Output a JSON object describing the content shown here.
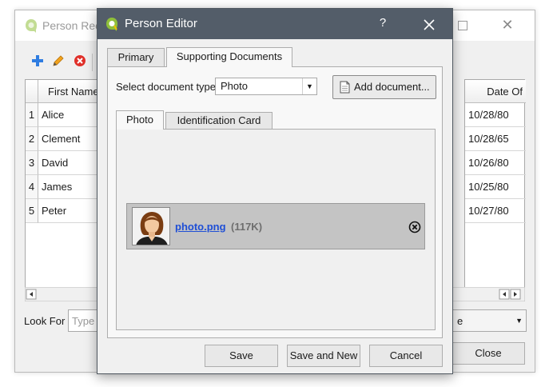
{
  "background_window": {
    "title": "Person Rec",
    "toolbar": {
      "add_icon": "plus-icon",
      "edit_icon": "pencil-icon",
      "delete_icon": "delete-icon"
    },
    "table": {
      "first_name_header": "First Name",
      "date_header": "Date Of",
      "rows": [
        {
          "num": "1",
          "first_name": "Alice",
          "date": "10/28/80"
        },
        {
          "num": "2",
          "first_name": "Clement",
          "date": "10/28/65"
        },
        {
          "num": "3",
          "first_name": "David",
          "date": "10/26/80"
        },
        {
          "num": "4",
          "first_name": "James",
          "date": "10/25/80"
        },
        {
          "num": "5",
          "first_name": "Peter",
          "date": "10/27/80"
        }
      ]
    },
    "look_for_label": "Look For",
    "look_for_placeholder": "Type t",
    "combo_value": "e",
    "close_label": "Close"
  },
  "dialog": {
    "title": "Person Editor",
    "help": "?",
    "tabs": [
      "Primary",
      "Supporting Documents"
    ],
    "select_label": "Select document type",
    "select_value": "Photo",
    "add_document_label": "Add document...",
    "inner_tabs": [
      "Photo",
      "Identification Card"
    ],
    "document": {
      "filename": "photo.png",
      "size": "(117K)"
    },
    "buttons": {
      "save": "Save",
      "save_and_new": "Save and New",
      "cancel": "Cancel"
    }
  },
  "colors": {
    "titlebar_bg": "#535d69",
    "link": "#1f4fd6",
    "doc_item_bg": "#c4c4c4"
  }
}
